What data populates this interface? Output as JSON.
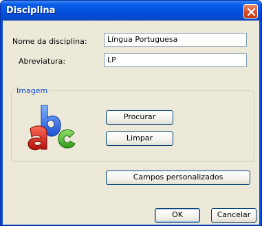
{
  "window": {
    "title": "Disciplina"
  },
  "fields": {
    "name_label": "Nome da disciplina:",
    "name_value": "Língua Portuguesa",
    "abbr_label": "Abreviatura:",
    "abbr_value": "LP"
  },
  "image_group": {
    "legend": "Imagem",
    "icon": "abc-icon",
    "browse_label": "Procurar",
    "clear_label": "Limpar"
  },
  "custom_fields_label": "Campos personalizados",
  "footer": {
    "ok_label": "OK",
    "cancel_label": "Cancelar"
  },
  "colors": {
    "accent": "#0046d5",
    "titlebar": "#0552e0",
    "close": "#d54a24"
  }
}
